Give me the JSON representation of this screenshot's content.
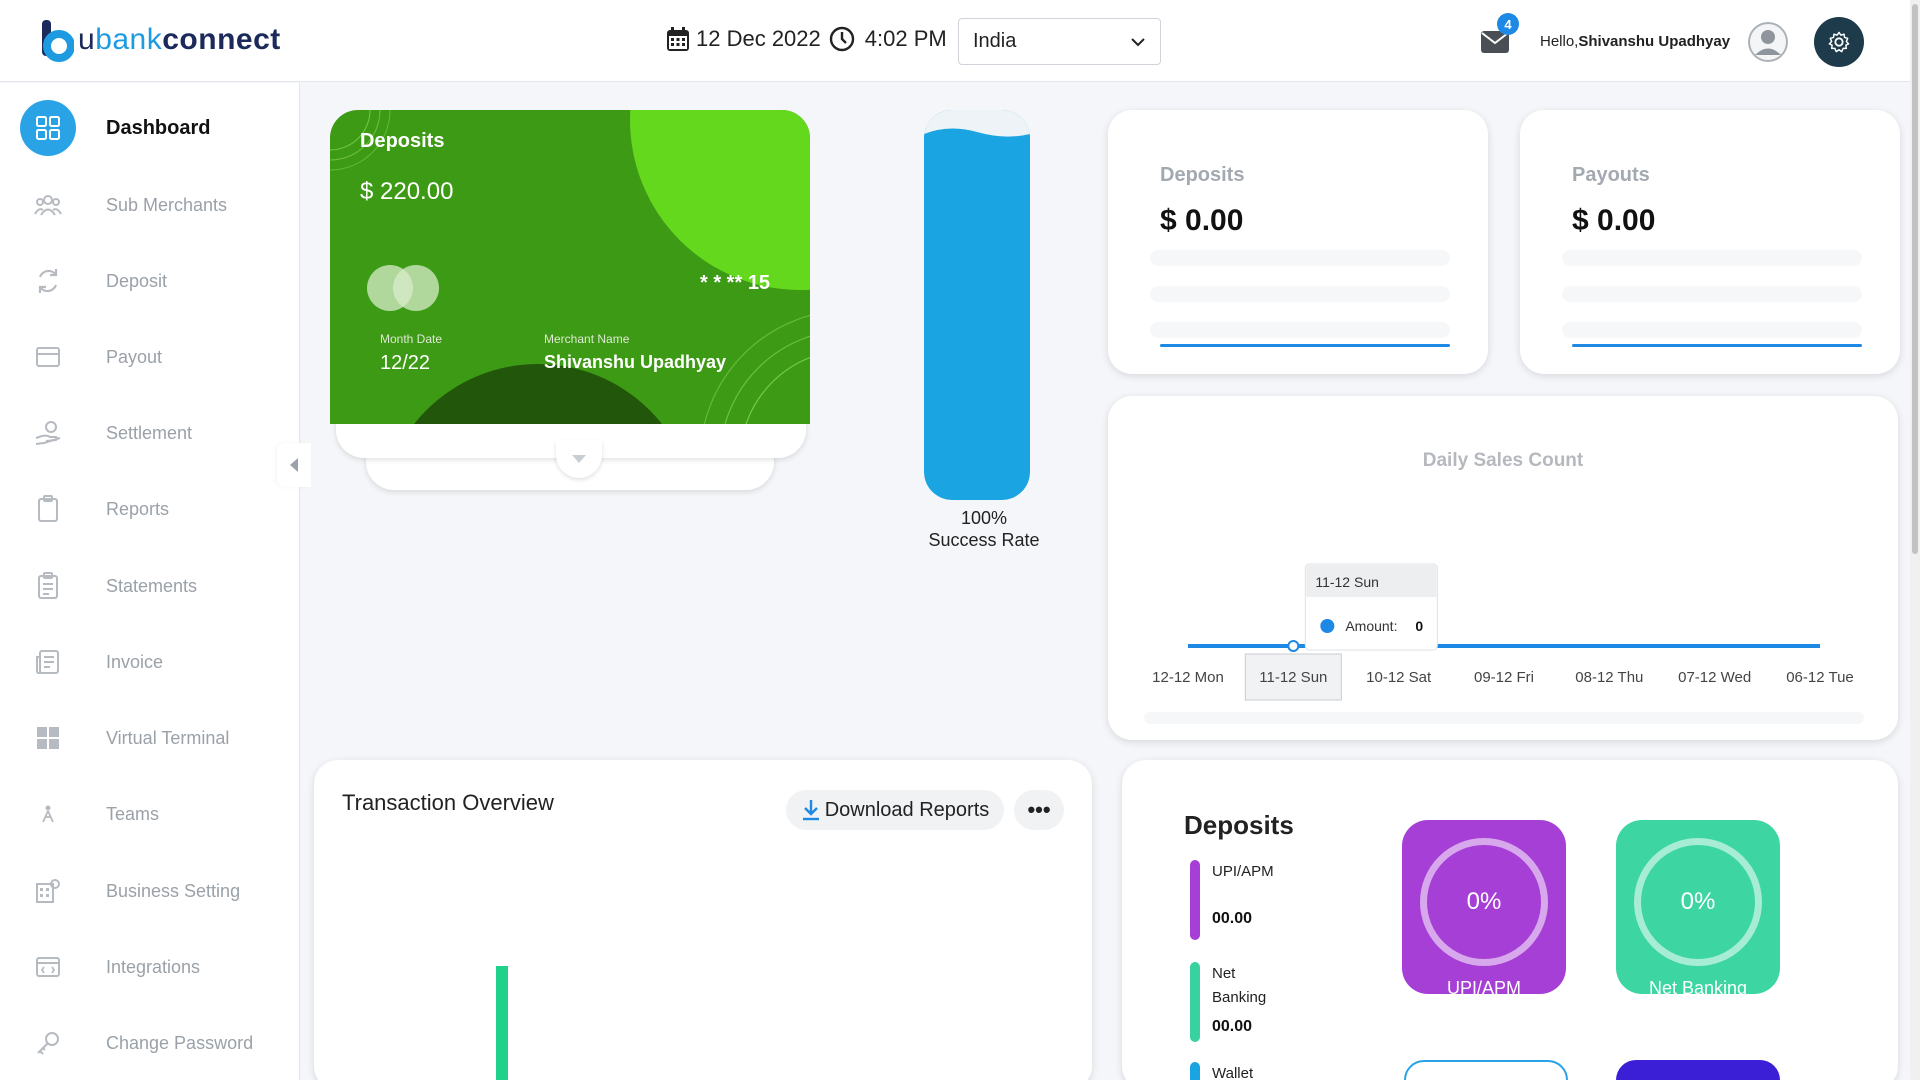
{
  "header": {
    "logo": {
      "u": "u",
      "bank": "bank",
      "connect": "connect"
    },
    "date": "12 Dec 2022",
    "time": "4:02 PM",
    "country": "India",
    "mail_count": "4",
    "greeting_prefix": "Hello,",
    "user_name": "Shivanshu Upadhyay"
  },
  "sidebar": {
    "items": [
      {
        "label": "Dashboard",
        "icon": "dashboard-icon",
        "active": true
      },
      {
        "label": "Sub Merchants",
        "icon": "sub-merchants-icon"
      },
      {
        "label": "Deposit",
        "icon": "deposit-icon"
      },
      {
        "label": "Payout",
        "icon": "payout-icon"
      },
      {
        "label": "Settlement",
        "icon": "settlement-icon"
      },
      {
        "label": "Reports",
        "icon": "reports-icon"
      },
      {
        "label": "Statements",
        "icon": "statements-icon"
      },
      {
        "label": "Invoice",
        "icon": "invoice-icon"
      },
      {
        "label": "Virtual Terminal",
        "icon": "virtual-terminal-icon"
      },
      {
        "label": "Teams",
        "icon": "teams-icon"
      },
      {
        "label": "Business Setting",
        "icon": "business-setting-icon"
      },
      {
        "label": "Integrations",
        "icon": "integrations-icon"
      },
      {
        "label": "Change Password",
        "icon": "change-password-icon"
      }
    ]
  },
  "deposit_card": {
    "title": "Deposits",
    "amount": "$ 220.00",
    "masked": "* * **",
    "last_digits": "15",
    "month_date_label": "Month Date",
    "month_date": "12/22",
    "merchant_label": "Merchant Name",
    "merchant_name": "Shivanshu Upadhyay",
    "colors": {
      "base": "#3d9a14",
      "accent": "#64d81d",
      "dark": "#22560a"
    }
  },
  "success_rate": {
    "percent": "100%",
    "label": "Success Rate",
    "value": 1.0,
    "color": "#1aa4e2"
  },
  "summary": {
    "deposits": {
      "title": "Deposits",
      "amount": "$ 0.00"
    },
    "payouts": {
      "title": "Payouts",
      "amount": "$ 0.00"
    }
  },
  "daily_sales": {
    "title": "Daily Sales Count",
    "tooltip": {
      "date": "11-12 Sun",
      "series": "Amount:",
      "value": "0"
    },
    "highlight_index": 1
  },
  "chart_data": {
    "type": "line",
    "title": "Daily Sales Count",
    "categories": [
      "12-12 Mon",
      "11-12 Sun",
      "10-12 Sat",
      "09-12 Fri",
      "08-12 Thu",
      "07-12 Wed",
      "06-12 Tue"
    ],
    "series": [
      {
        "name": "Amount",
        "values": [
          0,
          0,
          0,
          0,
          0,
          0,
          0
        ]
      }
    ],
    "color": "#1e88e5"
  },
  "transaction": {
    "title": "Transaction Overview",
    "download_label": "Download Reports",
    "more_label": "•••",
    "bar_color": "#1fd18a"
  },
  "deposits_breakdown": {
    "title": "Deposits",
    "legend": [
      {
        "label": "UPI/APM",
        "value": "00.00",
        "color": "#a63fd6"
      },
      {
        "label": "Net Banking",
        "value": "00.00",
        "color": "#39d1a0"
      },
      {
        "label": "Wallet",
        "value": "",
        "color": "#1aa4e2"
      }
    ],
    "tiles": [
      {
        "percent": "0%",
        "label": "UPI/APM",
        "color": "#a63fd6"
      },
      {
        "percent": "0%",
        "label": "Net Banking",
        "color": "#3dd6a3"
      }
    ]
  }
}
